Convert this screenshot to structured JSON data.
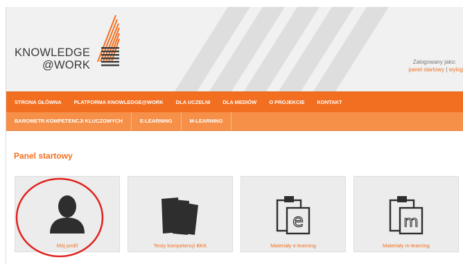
{
  "brand": {
    "line1": "KNOWLEDGE",
    "line2": "@WORK",
    "accent": "#f26f21"
  },
  "login": {
    "label": "Zalogowany jako:",
    "link_panel": "panel startowy",
    "separator": "|",
    "link_logout": "wylog"
  },
  "nav_primary": [
    {
      "label": "STRONA GŁÓWNA"
    },
    {
      "label": "PLATFORMA KNOWLEDGE@WORK"
    },
    {
      "label": "DLA UCZELNI"
    },
    {
      "label": "DLA MEDIÓW"
    },
    {
      "label": "O PROJEKCIE"
    },
    {
      "label": "KONTAKT"
    }
  ],
  "nav_secondary": [
    {
      "label": "BAROMETR KOMPETENCJI KLUCZOWYCH"
    },
    {
      "label": "E-LEARNING"
    },
    {
      "label": "M-LEARNING"
    }
  ],
  "main": {
    "title": "Panel startowy",
    "cards": [
      {
        "label": "Mój profil",
        "icon": "user-profile-icon"
      },
      {
        "label": "Testy kompetencji BKK",
        "icon": "test-sheets-icon"
      },
      {
        "label": "Materiały e-learning",
        "icon": "clipboard-e-icon",
        "letter": "e"
      },
      {
        "label": "Materiały m-learning",
        "icon": "clipboard-m-icon",
        "letter": "m"
      }
    ]
  }
}
